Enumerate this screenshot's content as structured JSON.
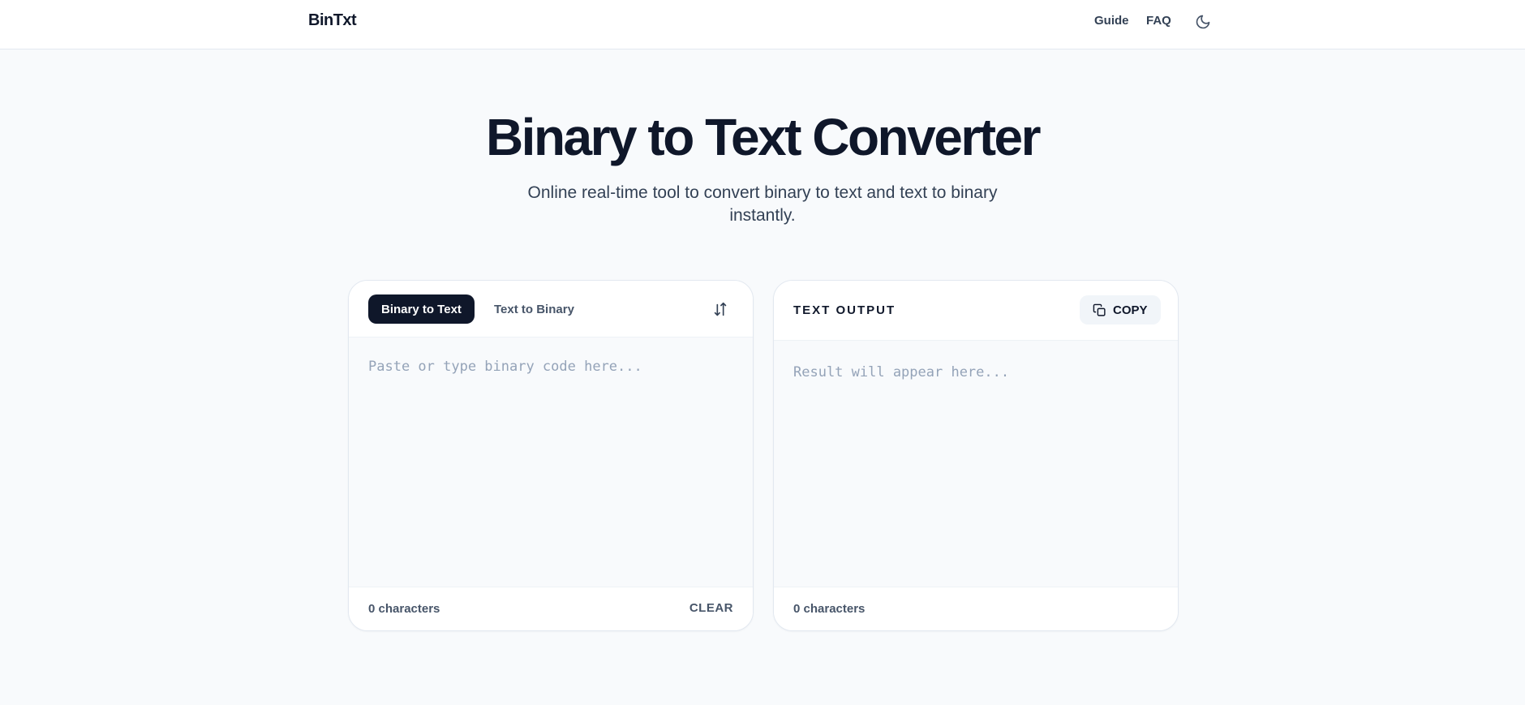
{
  "header": {
    "brand": "BinTxt",
    "nav": {
      "guide": "Guide",
      "faq": "FAQ"
    },
    "theme_icon": "moon-icon"
  },
  "hero": {
    "title": "Binary to Text Converter",
    "subtitle": "Online real-time tool to convert binary to text and text to binary instantly."
  },
  "input_panel": {
    "tabs": [
      {
        "label": "Binary to Text",
        "active": true
      },
      {
        "label": "Text to Binary",
        "active": false
      }
    ],
    "swap_icon": "swap-vertical-icon",
    "placeholder": "Paste or type binary code here...",
    "char_count": "0 characters",
    "clear_label": "CLEAR"
  },
  "output_panel": {
    "label": "TEXT OUTPUT",
    "copy_label": "COPY",
    "copy_icon": "copy-icon",
    "placeholder": "Result will appear here...",
    "char_count": "0 characters"
  },
  "colors": {
    "primary": "#0f172a",
    "muted": "#475569",
    "placeholder": "#94a3b8",
    "background": "#f8fafc",
    "border": "#e2e8f0"
  }
}
